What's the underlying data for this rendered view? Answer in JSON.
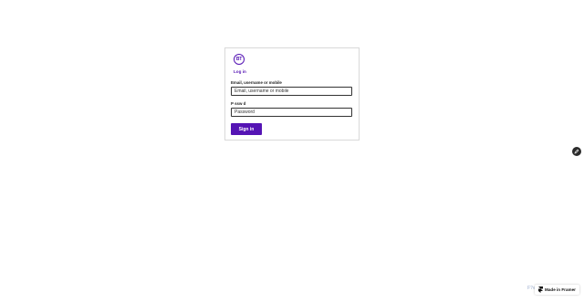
{
  "logo": {
    "text": "BT",
    "color": "#5514b4"
  },
  "login_link": "Log in",
  "email": {
    "label": "Email, username or mobile",
    "placeholder": "Email, username or mobile"
  },
  "password": {
    "label": "P  ssw  d",
    "placeholder": "Password"
  },
  "signin_label": "Sign in",
  "fab": {
    "icon": "pencil-icon"
  },
  "ghost_text": "F?e",
  "framer_badge": {
    "icon": "framer-logo-icon",
    "label": "Made in Framer"
  },
  "colors": {
    "accent": "#5514b4",
    "fab_bg": "#2b2b2b"
  }
}
